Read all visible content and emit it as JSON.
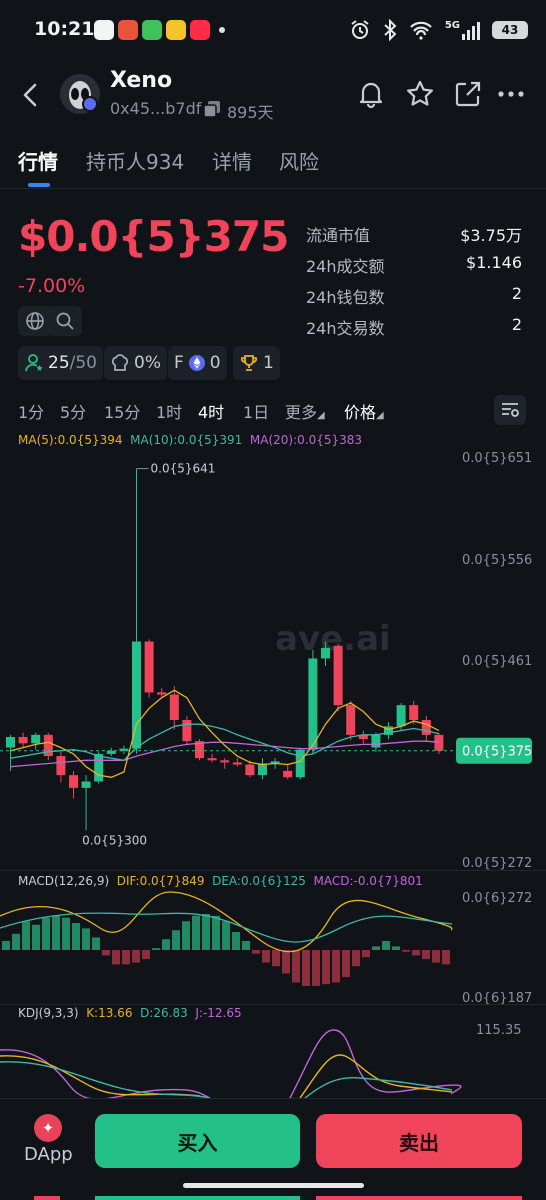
{
  "status": {
    "time": "10:21",
    "network": "5G",
    "battery": "43"
  },
  "header": {
    "name": "Xeno",
    "address": "0x45...b7df",
    "age": "895天"
  },
  "tabs": [
    "行情",
    "持币人934",
    "详情",
    "风险"
  ],
  "price": {
    "value": "$0.0{5}375",
    "change": "-7.00%"
  },
  "stats": [
    {
      "label": "流通市值",
      "value": "$3.75万"
    },
    {
      "label": "24h成交额",
      "value": "$1.146"
    },
    {
      "label": "24h钱包数",
      "value": "2"
    },
    {
      "label": "24h交易数",
      "value": "2"
    }
  ],
  "chips": {
    "holders_score": "25",
    "holders_total": "/50",
    "dev_pct": "0%",
    "f_label": "F",
    "f_value": "0",
    "trophy_value": "1"
  },
  "timeframes": [
    "1分",
    "5分",
    "15分",
    "1时",
    "4时",
    "1日",
    "更多",
    "价格"
  ],
  "ma": {
    "ma5": "MA(5):0.0{5}394",
    "ma10": "MA(10):0.0{5}391",
    "ma20": "MA(20):0.0{5}383"
  },
  "price_axis": {
    "p651": "0.0{5}651",
    "p556": "0.0{5}556",
    "p461": "0.0{5}461",
    "p375": "0.0{5}375",
    "p272": "0.0{5}272",
    "high": "0.0{5}641",
    "low": "0.0{5}300"
  },
  "macd": {
    "title": "MACD(12,26,9)",
    "dif": "DIF:0.0{7}849",
    "dea": "DEA:0.0{6}125",
    "macd": "MACD:-0.0{7}801",
    "axis_top": "0.0{6}272",
    "axis_bottom": "0.0{6}187"
  },
  "kdj": {
    "title": "KDJ(9,3,3)",
    "k": "K:13.66",
    "d": "D:26.83",
    "j": "J:-12.65",
    "axis_top": "115.35"
  },
  "watermark": "ave.ai",
  "bottom": {
    "dapp": "DApp",
    "buy": "买入",
    "sell": "卖出"
  },
  "colors": {
    "up": "#24c08a",
    "down": "#f0445b",
    "ma5": "#e6b422",
    "ma10": "#3fb8a6",
    "ma20": "#c266d9",
    "accent": "#3b82f6"
  },
  "chart_data": {
    "type": "candlestick",
    "timeframe": "4时",
    "candles": [
      {
        "open": 378,
        "high": 390,
        "low": 356,
        "close": 388
      },
      {
        "open": 388,
        "high": 392,
        "low": 378,
        "close": 382
      },
      {
        "open": 382,
        "high": 392,
        "low": 376,
        "close": 390
      },
      {
        "open": 390,
        "high": 392,
        "low": 366,
        "close": 370
      },
      {
        "open": 370,
        "high": 374,
        "low": 345,
        "close": 352
      },
      {
        "open": 352,
        "high": 356,
        "low": 330,
        "close": 340
      },
      {
        "open": 340,
        "high": 352,
        "low": 300,
        "close": 346
      },
      {
        "open": 346,
        "high": 374,
        "low": 344,
        "close": 372
      },
      {
        "open": 372,
        "high": 378,
        "low": 370,
        "close": 375
      },
      {
        "open": 375,
        "high": 380,
        "low": 372,
        "close": 377
      },
      {
        "open": 377,
        "high": 641,
        "low": 372,
        "close": 478
      },
      {
        "open": 478,
        "high": 480,
        "low": 425,
        "close": 430
      },
      {
        "open": 430,
        "high": 434,
        "low": 426,
        "close": 428
      },
      {
        "open": 428,
        "high": 436,
        "low": 395,
        "close": 404
      },
      {
        "open": 404,
        "high": 408,
        "low": 380,
        "close": 384
      },
      {
        "open": 384,
        "high": 386,
        "low": 366,
        "close": 368
      },
      {
        "open": 368,
        "high": 372,
        "low": 364,
        "close": 366
      },
      {
        "open": 366,
        "high": 368,
        "low": 358,
        "close": 364
      },
      {
        "open": 364,
        "high": 368,
        "low": 360,
        "close": 362
      },
      {
        "open": 362,
        "high": 366,
        "low": 350,
        "close": 352
      },
      {
        "open": 352,
        "high": 368,
        "low": 348,
        "close": 363
      },
      {
        "open": 363,
        "high": 368,
        "low": 358,
        "close": 365
      },
      {
        "open": 356,
        "high": 362,
        "low": 348,
        "close": 350
      },
      {
        "open": 350,
        "high": 378,
        "low": 348,
        "close": 376
      },
      {
        "open": 376,
        "high": 470,
        "low": 372,
        "close": 462
      },
      {
        "open": 462,
        "high": 478,
        "low": 455,
        "close": 472
      },
      {
        "open": 474,
        "high": 476,
        "low": 412,
        "close": 418
      },
      {
        "open": 418,
        "high": 422,
        "low": 385,
        "close": 390
      },
      {
        "open": 390,
        "high": 394,
        "low": 382,
        "close": 386
      },
      {
        "open": 378,
        "high": 392,
        "low": 374,
        "close": 390
      },
      {
        "open": 390,
        "high": 402,
        "low": 386,
        "close": 398
      },
      {
        "open": 398,
        "high": 420,
        "low": 394,
        "close": 418
      },
      {
        "open": 418,
        "high": 422,
        "low": 400,
        "close": 404
      },
      {
        "open": 404,
        "high": 408,
        "low": 384,
        "close": 390
      },
      {
        "open": 390,
        "high": 392,
        "low": 372,
        "close": 375
      }
    ],
    "ma5": [
      375,
      378,
      381,
      383,
      378,
      372,
      360,
      352,
      350,
      355,
      400,
      415,
      425,
      432,
      425,
      405,
      392,
      380,
      370,
      364,
      362,
      363,
      362,
      365,
      380,
      400,
      415,
      420,
      412,
      400,
      395,
      398,
      403,
      400,
      394
    ],
    "ma10": [
      368,
      370,
      372,
      374,
      375,
      376,
      374,
      370,
      368,
      366,
      378,
      386,
      392,
      398,
      400,
      400,
      398,
      395,
      390,
      386,
      382,
      378,
      373,
      370,
      372,
      378,
      384,
      388,
      390,
      390,
      392,
      394,
      396,
      394,
      391
    ],
    "ma20": [
      360,
      361,
      362,
      363,
      364,
      365,
      366,
      366,
      366,
      366,
      370,
      373,
      376,
      379,
      381,
      382,
      383,
      383,
      382,
      381,
      380,
      379,
      378,
      377,
      377,
      378,
      379,
      380,
      381,
      381,
      382,
      383,
      384,
      384,
      383
    ],
    "y_ticks": [
      651,
      556,
      461,
      375,
      272
    ],
    "ylim": [
      272,
      651
    ],
    "y_unit": "×10^-7"
  }
}
